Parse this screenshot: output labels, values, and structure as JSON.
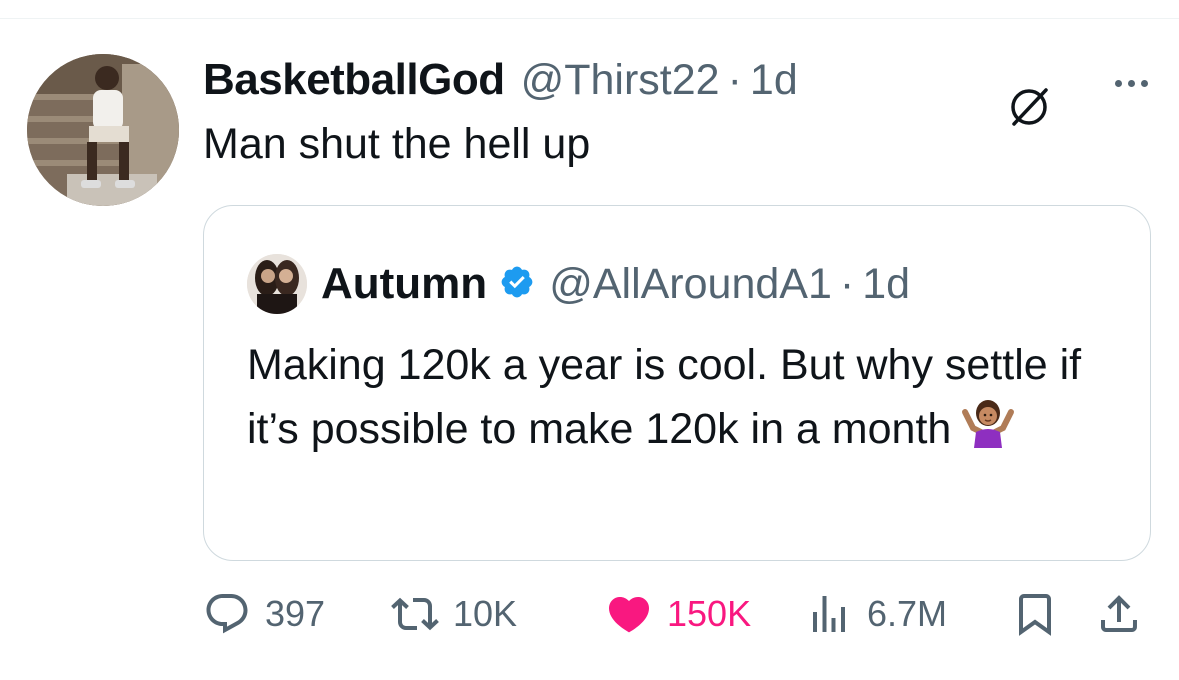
{
  "tweet": {
    "author_name": "BasketballGod",
    "handle": "@Thirst22",
    "separator": "·",
    "time": "1d",
    "text": "Man shut the hell up",
    "icons": {
      "avatar": "user-avatar-photo",
      "grok": "grok-icon",
      "more": "more-icon"
    }
  },
  "quote": {
    "author_name": "Autumn",
    "verified": true,
    "handle": "@AllAroundA1",
    "separator": "·",
    "time": "1d",
    "text": "Making 120k a year is cool. But why settle if it’s possible to make 120k in a month",
    "emoji": "woman-shrugging-emoji"
  },
  "actions": {
    "replies": "397",
    "reposts": "10K",
    "likes": "150K",
    "views": "6.7M",
    "liked": true
  },
  "colors": {
    "text": "#0f1419",
    "secondary": "#536471",
    "like": "#f91880",
    "verified": "#1d9bf0",
    "border": "#cfd9de"
  }
}
